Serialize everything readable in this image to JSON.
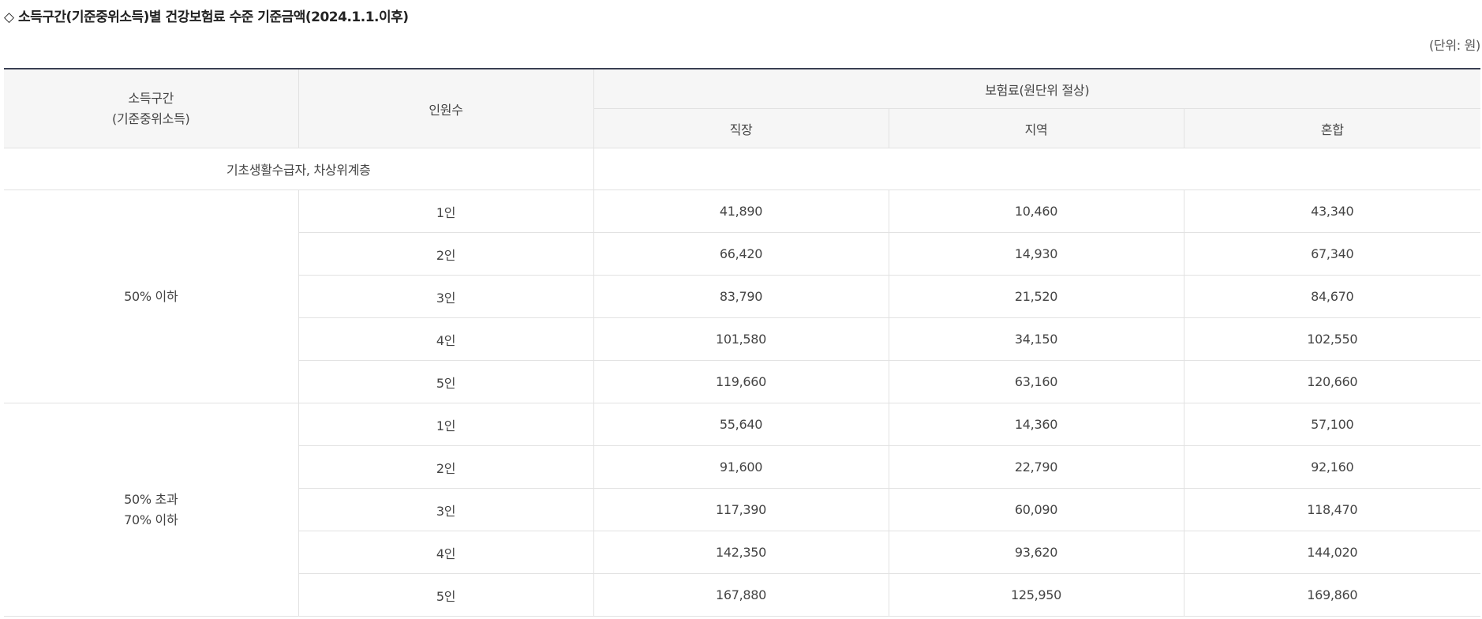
{
  "title": "◇ 소득구간(기준중위소득)별 건강보험료 수준 기준금액(2024.1.1.이후)",
  "unit": "(단위: 원)",
  "table": {
    "headers": {
      "income": "소득구간",
      "income_sub": "(기준중위소득)",
      "persons": "인원수",
      "premium": "보험료(원단위 절상)",
      "employee": "직장",
      "region": "지역",
      "mixed": "혼합"
    },
    "basic_row": "기초생활수급자, 차상위계층",
    "groups": [
      {
        "label_line1": "50% 이하",
        "label_line2": "",
        "rows": [
          {
            "persons": "1인",
            "employee": "41,890",
            "region": "10,460",
            "mixed": "43,340"
          },
          {
            "persons": "2인",
            "employee": "66,420",
            "region": "14,930",
            "mixed": "67,340"
          },
          {
            "persons": "3인",
            "employee": "83,790",
            "region": "21,520",
            "mixed": "84,670"
          },
          {
            "persons": "4인",
            "employee": "101,580",
            "region": "34,150",
            "mixed": "102,550"
          },
          {
            "persons": "5인",
            "employee": "119,660",
            "region": "63,160",
            "mixed": "120,660"
          }
        ]
      },
      {
        "label_line1": "50% 초과",
        "label_line2": "70% 이하",
        "rows": [
          {
            "persons": "1인",
            "employee": "55,640",
            "region": "14,360",
            "mixed": "57,100"
          },
          {
            "persons": "2인",
            "employee": "91,600",
            "region": "22,790",
            "mixed": "92,160"
          },
          {
            "persons": "3인",
            "employee": "117,390",
            "region": "60,090",
            "mixed": "118,470"
          },
          {
            "persons": "4인",
            "employee": "142,350",
            "region": "93,620",
            "mixed": "144,020"
          },
          {
            "persons": "5인",
            "employee": "167,880",
            "region": "125,950",
            "mixed": "169,860"
          }
        ]
      }
    ]
  }
}
